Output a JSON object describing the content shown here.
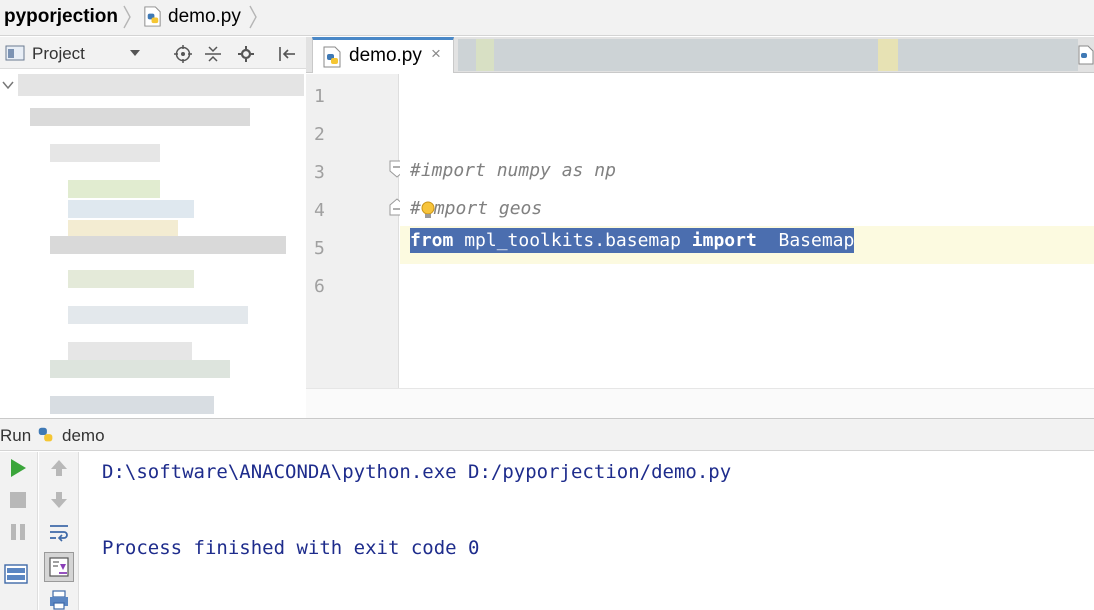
{
  "breadcrumb": {
    "project": "pyporjection",
    "file": "demo.py"
  },
  "project_panel": {
    "title": "Project"
  },
  "editor": {
    "tab": {
      "label": "demo.py",
      "close": "×"
    },
    "line_numbers": [
      "1",
      "2",
      "3",
      "4",
      "5",
      "6"
    ],
    "lines": {
      "line3": "#import numpy as np",
      "line4_hash": "#",
      "line4_rest": "mport geos",
      "line5_from": "from",
      "line5_module": " mpl_toolkits.basemap ",
      "line5_import": "import",
      "line5_name": "  Basemap"
    }
  },
  "run": {
    "label": "Run",
    "config": "demo",
    "console": [
      "D:\\software\\ANACONDA\\python.exe D:/pyporjection/demo.py",
      "Process finished with exit code 0"
    ]
  },
  "colors": {
    "selection": "#4b6eaf",
    "comment": "#808080",
    "console_text": "#1e2c8c",
    "run_green": "#3aa53a",
    "current_line": "#fcfae0"
  },
  "icons": {
    "file": "python-file-icon",
    "project": "project-icon",
    "run": "run-icon",
    "stop": "stop-icon",
    "pause": "pause-icon",
    "up": "arrow-up-icon",
    "down": "arrow-down-icon",
    "wrap": "soft-wrap-icon",
    "scroll": "scroll-to-end-icon",
    "print": "print-icon",
    "layout": "restore-layout-icon",
    "bulb": "intention-bulb-icon"
  }
}
